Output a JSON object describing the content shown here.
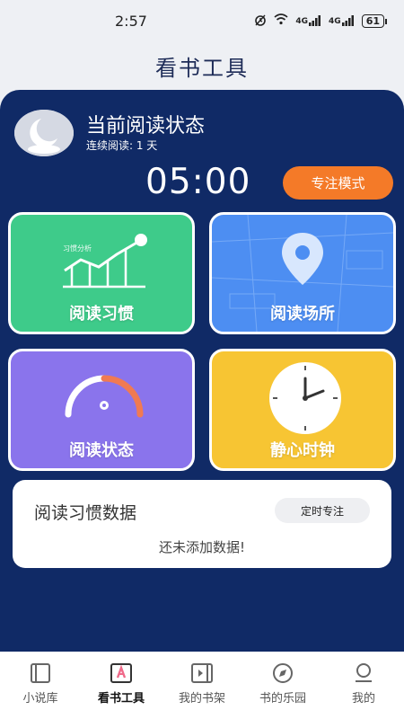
{
  "status_bar": {
    "time": "2:57",
    "signal_1": "4G",
    "signal_2": "4G",
    "battery": "61"
  },
  "header": {
    "title": "看书工具"
  },
  "reading": {
    "title": "当前阅读状态",
    "streak": "连续阅读: 1 天",
    "timer": "05:00",
    "focus_button": "专注模式"
  },
  "cards": [
    {
      "label": "阅读习惯",
      "color": "#3ecb8a",
      "icon": "chart-icon"
    },
    {
      "label": "阅读场所",
      "color": "#4d8ef2",
      "icon": "map-pin-icon"
    },
    {
      "label": "阅读状态",
      "color": "#8a74ec",
      "icon": "gauge-icon"
    },
    {
      "label": "静心时钟",
      "color": "#f7c533",
      "icon": "clock-icon"
    }
  ],
  "habit_data": {
    "title": "阅读习惯数据",
    "button": "定时专注",
    "empty": "还未添加数据!"
  },
  "tabs": [
    {
      "label": "小说库",
      "icon": "library-icon"
    },
    {
      "label": "看书工具",
      "icon": "tools-icon",
      "active": true
    },
    {
      "label": "我的书架",
      "icon": "bookshelf-icon"
    },
    {
      "label": "书的乐园",
      "icon": "compass-icon"
    },
    {
      "label": "我的",
      "icon": "profile-icon"
    }
  ],
  "colors": {
    "panel": "#102a66",
    "accent": "#f47a28"
  }
}
